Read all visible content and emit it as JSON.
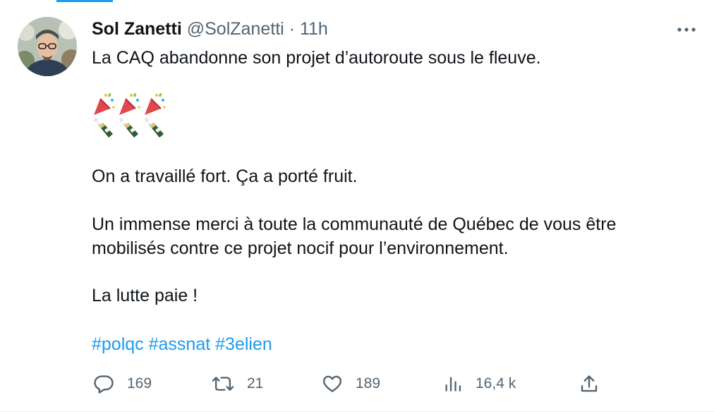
{
  "author": {
    "name": "Sol Zanetti",
    "handle": "@SolZanetti",
    "separator": "·",
    "time": "11h"
  },
  "tweet": {
    "line1": "La CAQ abandonne son projet d’autoroute sous le fleuve.",
    "emoji_row1": [
      "party-popper-icon",
      "party-popper-icon",
      "party-popper-icon"
    ],
    "emoji_row2": [
      "champagne-icon",
      "champagne-icon",
      "champagne-icon"
    ],
    "line2": "On a travaillé fort. Ça a porté fruit.",
    "line3a": "Un immense merci à toute la communauté de Québec de vous être",
    "line3b": "mobilisés contre ce projet nocif pour l’environnement.",
    "line4": "La lutte paie !",
    "hashtags": [
      "#polqc",
      "#assnat",
      "#3elien"
    ]
  },
  "actions": {
    "replies": "169",
    "retweets": "21",
    "likes": "189",
    "views": "16,4 k"
  },
  "colors": {
    "text": "#0f1419",
    "muted": "#536471",
    "accent": "#1d9bf0"
  }
}
